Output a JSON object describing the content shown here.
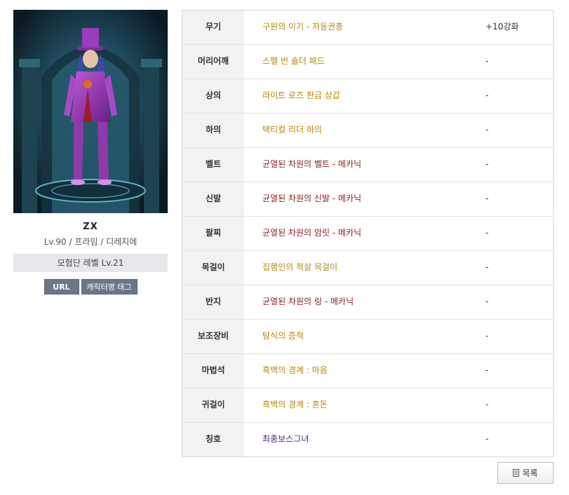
{
  "character": {
    "name": "ZX",
    "info": "Lv.90 / 프라임 / 디레지에",
    "guild_level": "모험단 레벨 Lv.21",
    "portrait_icon": "character-portrait"
  },
  "buttons": {
    "url": "URL",
    "name_tag": "캐릭터명 태그",
    "list": "목록",
    "list_icon": "document-icon"
  },
  "colors": {
    "rare": "#b8860b",
    "set": "#8b1a1a",
    "title": "#4b1c7a"
  },
  "equipment": [
    {
      "slot": "무기",
      "item": "구원의 이기 - 자동권총",
      "grade": "rare",
      "enhance": "+10강화"
    },
    {
      "slot": "머리어깨",
      "item": "스펠 번 숄더 패드",
      "grade": "rare",
      "enhance": "-"
    },
    {
      "slot": "상의",
      "item": "라이트 로즈 판금 상갑",
      "grade": "rare",
      "enhance": "-"
    },
    {
      "slot": "하의",
      "item": "택티컬 리더 하의",
      "grade": "rare",
      "enhance": "-"
    },
    {
      "slot": "벨트",
      "item": "균열된 차원의 벨트 - 메카닉",
      "grade": "set",
      "enhance": "-"
    },
    {
      "slot": "신발",
      "item": "균열된 차원의 신발 - 메카닉",
      "grade": "set",
      "enhance": "-"
    },
    {
      "slot": "팔찌",
      "item": "균열된 차원의 암릿 - 메카닉",
      "grade": "set",
      "enhance": "-"
    },
    {
      "slot": "목걸이",
      "item": "집행인의 척살 목걸이",
      "grade": "rare",
      "enhance": "-"
    },
    {
      "slot": "반지",
      "item": "균열된 차원의 링 - 메카닉",
      "grade": "set",
      "enhance": "-"
    },
    {
      "slot": "보조장비",
      "item": "탐식의 증적",
      "grade": "rare",
      "enhance": "-"
    },
    {
      "slot": "마법석",
      "item": "흑백의 경계 : 마음",
      "grade": "rare",
      "enhance": "-"
    },
    {
      "slot": "귀걸이",
      "item": "흑백의 경계 : 혼돈",
      "grade": "rare",
      "enhance": "-"
    },
    {
      "slot": "칭호",
      "item": "최종보스그녀",
      "grade": "title",
      "enhance": "-"
    }
  ]
}
